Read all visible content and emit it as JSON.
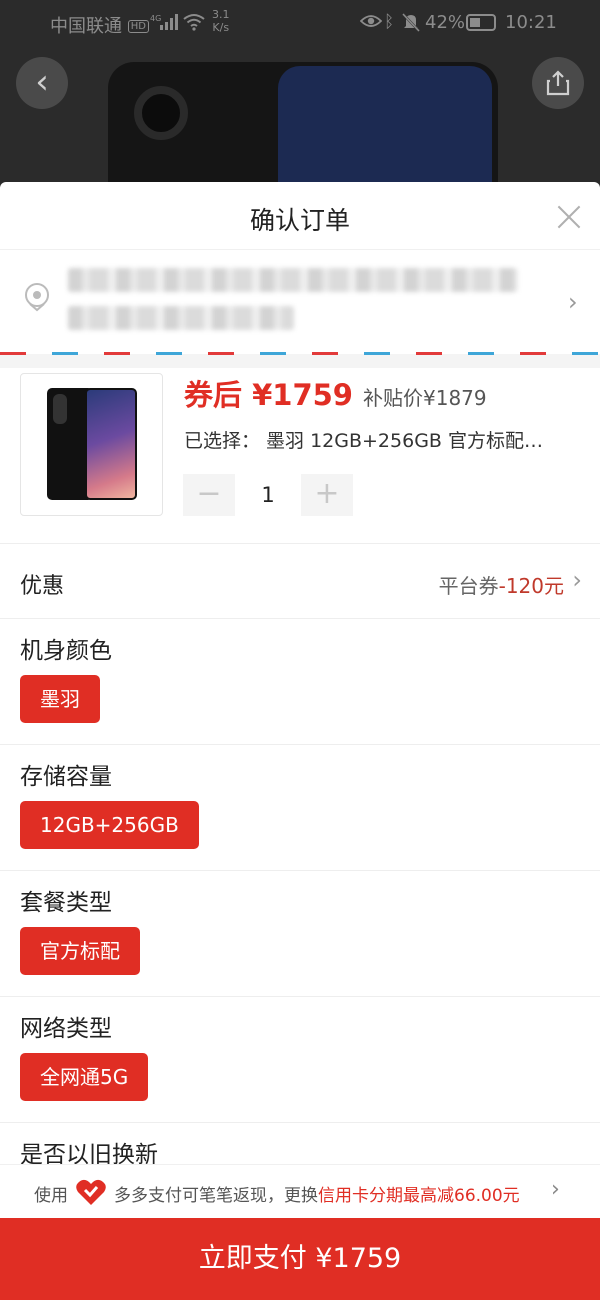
{
  "status_bar": {
    "carrier": "中国联通",
    "hd": "HD",
    "network": "4G",
    "speed_value": "3.1",
    "speed_unit": "K/s",
    "battery": "42%",
    "time": "10:21"
  },
  "header": {
    "title": "确认订单"
  },
  "product": {
    "price": "券后 ¥1759",
    "original_price": "补贴价¥1879",
    "selected": "已选择： 墨羽 12GB+256GB 官方标配…",
    "quantity": "1",
    "minus": "−",
    "plus": "+"
  },
  "discount": {
    "label": "优惠",
    "value_prefix": "平台券",
    "value_amount": "-120元"
  },
  "options": [
    {
      "label": "机身颜色",
      "selected": "墨羽"
    },
    {
      "label": "存储容量",
      "selected": "12GB+256GB"
    },
    {
      "label": "套餐类型",
      "selected": "官方标配"
    },
    {
      "label": "网络类型",
      "selected": "全网通5G"
    }
  ],
  "trade_in": {
    "label": "是否以旧换新"
  },
  "pay_banner": {
    "prefix": "使用",
    "text": "多多支付可笔笔返现，更换",
    "highlight": "信用卡分期最高减66.00元"
  },
  "pay_button": {
    "label": "立即支付 ¥1759"
  },
  "colors": {
    "accent": "#e02e24"
  }
}
